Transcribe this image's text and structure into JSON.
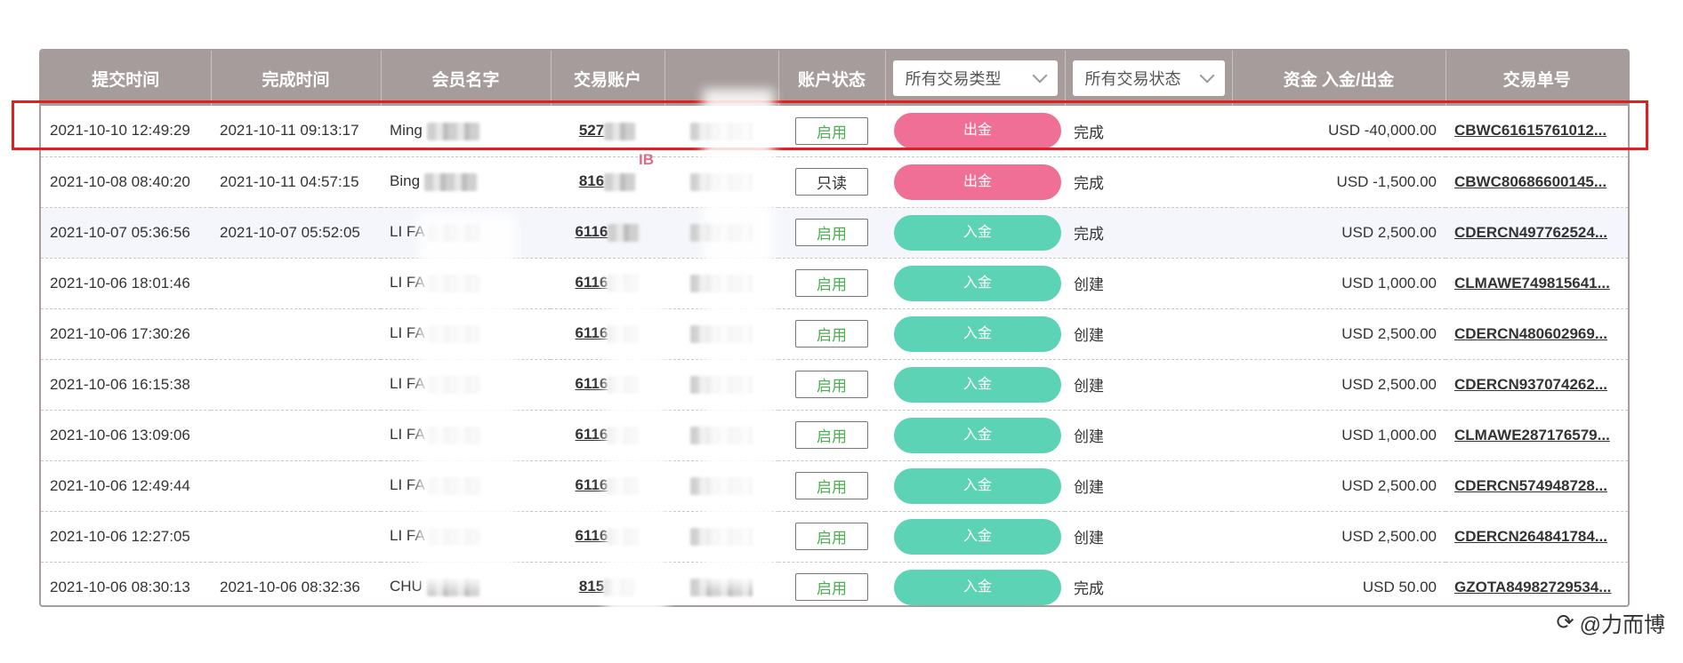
{
  "table": {
    "headers": {
      "submit_time": "提交时间",
      "complete_time": "完成时间",
      "member_name": "会员名字",
      "trade_account": "交易账户",
      "blank": "",
      "account_status": "账户状态",
      "type_filter": "所有交易类型",
      "status_filter": "所有交易状态",
      "amount": "资金 入金/出金",
      "order_no": "交易单号"
    },
    "rows": [
      {
        "submit": "2021-10-10 12:49:29",
        "complete": "2021-10-11 09:13:17",
        "name": "Ming",
        "account": "527",
        "acct_status": "启用",
        "acct_status_kind": "enabled",
        "type": "出金",
        "type_kind": "out",
        "tx_status": "完成",
        "amount": "USD -40,000.00",
        "order": "CBWC61615761012...",
        "highlighted": true
      },
      {
        "submit": "2021-10-08 08:40:20",
        "complete": "2021-10-11 04:57:15",
        "name": "Bing",
        "account": "816",
        "acct_status": "只读",
        "acct_status_kind": "readonly",
        "type": "出金",
        "type_kind": "out",
        "tx_status": "完成",
        "amount": "USD -1,500.00",
        "order": "CBWC80686600145..."
      },
      {
        "submit": "2021-10-07 05:36:56",
        "complete": "2021-10-07 05:52:05",
        "name": "LI FA",
        "account": "6116",
        "acct_status": "启用",
        "acct_status_kind": "enabled",
        "type": "入金",
        "type_kind": "in",
        "tx_status": "完成",
        "amount": "USD 2,500.00",
        "order": "CDERCN497762524...",
        "alt": true
      },
      {
        "submit": "2021-10-06 18:01:46",
        "complete": "",
        "name": "LI FA",
        "account": "6116",
        "acct_status": "启用",
        "acct_status_kind": "enabled",
        "type": "入金",
        "type_kind": "in",
        "tx_status": "创建",
        "amount": "USD 1,000.00",
        "order": "CLMAWE749815641..."
      },
      {
        "submit": "2021-10-06 17:30:26",
        "complete": "",
        "name": "LI FA",
        "account": "6116",
        "acct_status": "启用",
        "acct_status_kind": "enabled",
        "type": "入金",
        "type_kind": "in",
        "tx_status": "创建",
        "amount": "USD 2,500.00",
        "order": "CDERCN480602969..."
      },
      {
        "submit": "2021-10-06 16:15:38",
        "complete": "",
        "name": "LI FA",
        "account": "6116",
        "acct_status": "启用",
        "acct_status_kind": "enabled",
        "type": "入金",
        "type_kind": "in",
        "tx_status": "创建",
        "amount": "USD 2,500.00",
        "order": "CDERCN937074262..."
      },
      {
        "submit": "2021-10-06 13:09:06",
        "complete": "",
        "name": "LI FA",
        "account": "6116",
        "acct_status": "启用",
        "acct_status_kind": "enabled",
        "type": "入金",
        "type_kind": "in",
        "tx_status": "创建",
        "amount": "USD 1,000.00",
        "order": "CLMAWE287176579..."
      },
      {
        "submit": "2021-10-06 12:49:44",
        "complete": "",
        "name": "LI FA",
        "account": "6116",
        "acct_status": "启用",
        "acct_status_kind": "enabled",
        "type": "入金",
        "type_kind": "in",
        "tx_status": "创建",
        "amount": "USD 2,500.00",
        "order": "CDERCN574948728..."
      },
      {
        "submit": "2021-10-06 12:27:05",
        "complete": "",
        "name": "LI FA",
        "account": "6116",
        "acct_status": "启用",
        "acct_status_kind": "enabled",
        "type": "入金",
        "type_kind": "in",
        "tx_status": "创建",
        "amount": "USD 2,500.00",
        "order": "CDERCN264841784..."
      },
      {
        "submit": "2021-10-06 08:30:13",
        "complete": "2021-10-06 08:32:36",
        "name": "CHU",
        "account": "815",
        "acct_status": "启用",
        "acct_status_kind": "enabled",
        "type": "入金",
        "type_kind": "in",
        "tx_status": "完成",
        "amount": "USD 50.00",
        "order": "GZOTA84982729534..."
      }
    ]
  },
  "ib_tag": "IB",
  "watermark": {
    "icon": "weibo-icon",
    "text": "@力而博"
  },
  "colors": {
    "header_bg": "#a59c9b",
    "withdraw": "#ef6f97",
    "deposit": "#5dd3b6",
    "enabled": "#4caf50",
    "highlight": "#e02020"
  }
}
